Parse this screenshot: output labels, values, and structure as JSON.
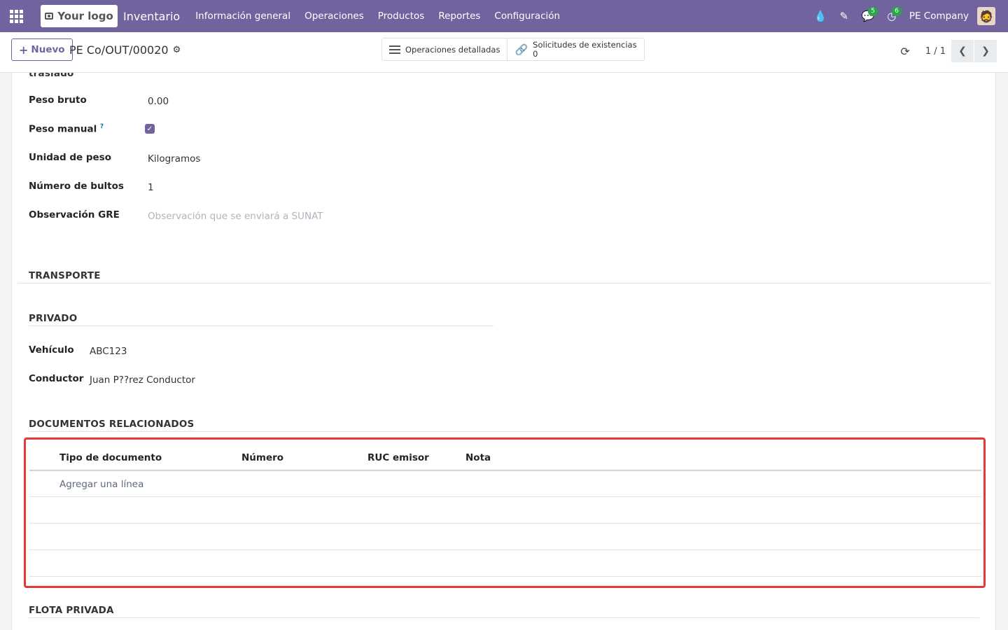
{
  "navbar": {
    "logo_text": "Your logo",
    "app_name": "Inventario",
    "menu": [
      "Información general",
      "Operaciones",
      "Productos",
      "Reportes",
      "Configuración"
    ],
    "messages_count": "5",
    "activities_count": "6",
    "company": "PE Company"
  },
  "control": {
    "new_label": "Nuevo",
    "record_name": "PE Co/OUT/00020",
    "detailed_ops_label": "Operaciones detalladas",
    "stock_requests_label": "Solicitudes de existencias",
    "stock_requests_count": "0",
    "pager": "1 / 1"
  },
  "form": {
    "cut_label": "traslado",
    "gross_weight_label": "Peso bruto",
    "gross_weight_value": "0.00",
    "manual_weight_label": "Peso manual",
    "manual_weight_help": "?",
    "weight_unit_label": "Unidad de peso",
    "weight_unit_value": "Kilogramos",
    "packages_label": "Número de bultos",
    "packages_value": "1",
    "gre_note_label": "Observación GRE",
    "gre_note_placeholder": "Observación que se enviará a SUNAT",
    "transport_title": "TRANSPORTE",
    "private_title": "PRIVADO",
    "vehicle_label": "Vehículo",
    "vehicle_value": "ABC123",
    "driver_label": "Conductor",
    "driver_value": "Juan P??rez Conductor",
    "related_docs_title": "DOCUMENTOS RELACIONADOS",
    "private_fleet_title": "FLOTA PRIVADA"
  },
  "related_docs_table": {
    "columns": [
      "Tipo de documento",
      "Número",
      "RUC emisor",
      "Nota"
    ],
    "add_line_label": "Agregar una línea"
  },
  "colors": {
    "navbar": "#71639e",
    "highlight_border": "#e53935",
    "badge": "#28a745"
  }
}
